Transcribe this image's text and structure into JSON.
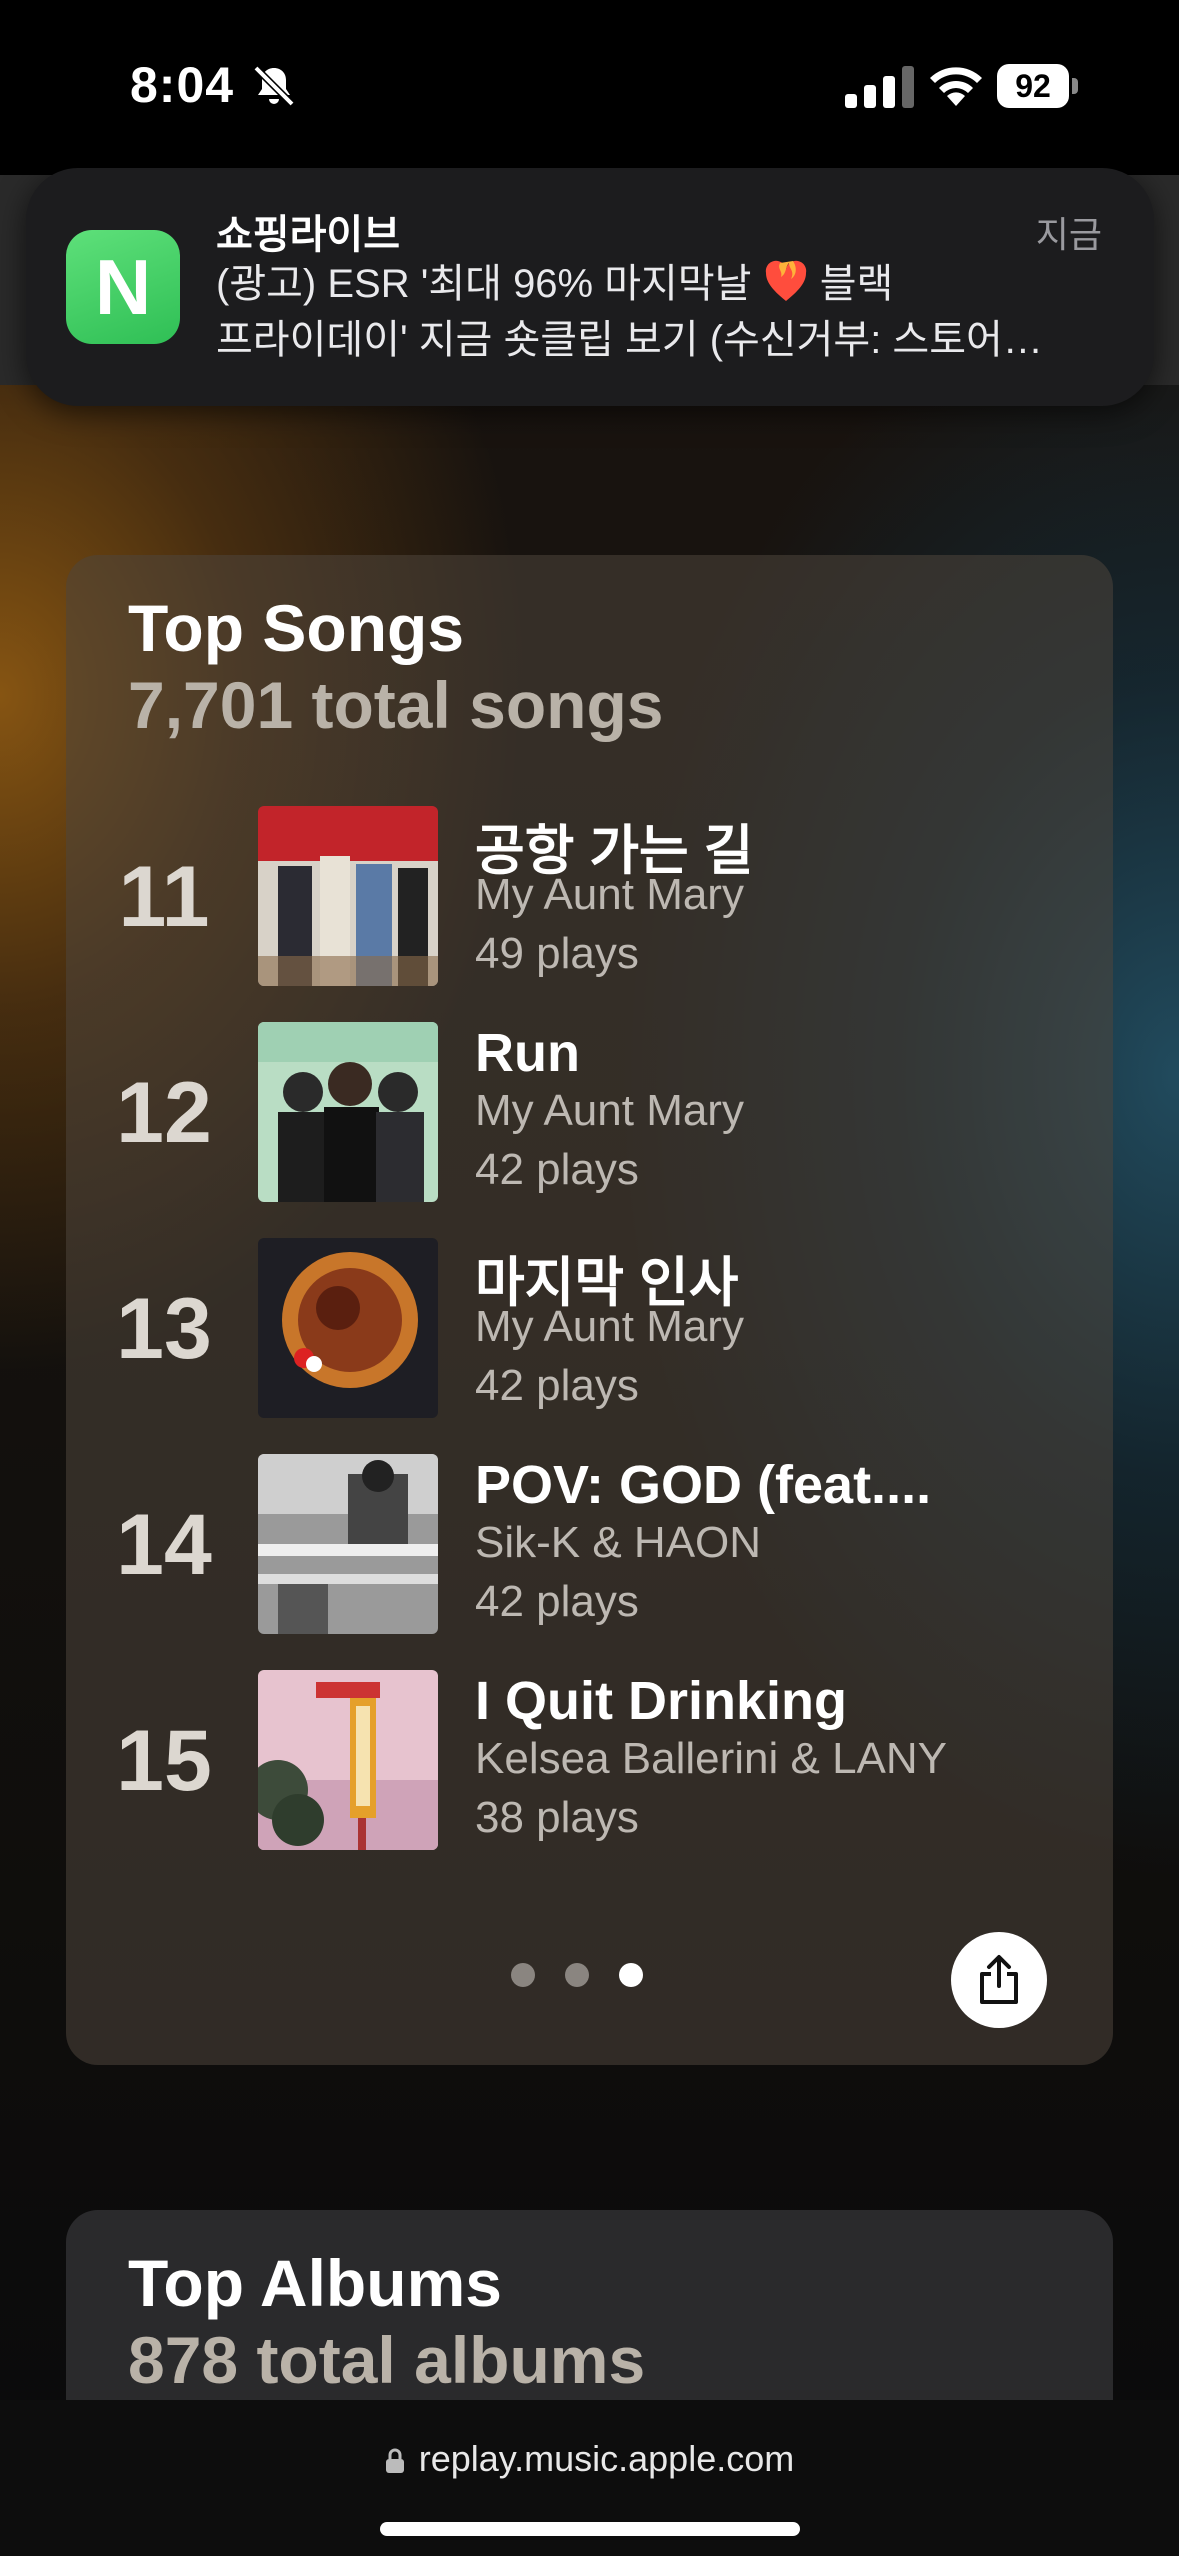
{
  "status_bar": {
    "time": "8:04",
    "battery": "92"
  },
  "notification": {
    "app_icon_letter": "N",
    "app_name": "쇼핑라이브",
    "time": "지금",
    "line1_a": "(광고) ESR '최대 96% 마지막날",
    "line1_b": "블랙",
    "line2": "프라이데이' 지금 숏클립 보기 (수신거부: 스토어…"
  },
  "top_songs": {
    "title": "Top Songs",
    "subtitle": "7,701 total songs",
    "songs": [
      {
        "rank": "11",
        "title": "공항 가는 길",
        "artist": "My Aunt Mary",
        "plays": "49 plays",
        "art_icon": "album-art-red-crowd"
      },
      {
        "rank": "12",
        "title": "Run",
        "artist": "My Aunt Mary",
        "plays": "42 plays",
        "art_icon": "album-art-right-now"
      },
      {
        "rank": "13",
        "title": "마지막 인사",
        "artist": "My Aunt Mary",
        "plays": "42 plays",
        "art_icon": "album-art-orange-sun"
      },
      {
        "rank": "14",
        "title": "POV: GOD (feat....",
        "artist": "Sik-K & HAON",
        "plays": "42 plays",
        "art_icon": "album-art-bw-photo"
      },
      {
        "rank": "15",
        "title": "I Quit Drinking",
        "artist": "Kelsea Ballerini & LANY",
        "plays": "38 plays",
        "art_icon": "album-art-liquor-sign"
      }
    ],
    "page_count": 3,
    "active_page": 3
  },
  "top_albums": {
    "title": "Top Albums",
    "subtitle": "878 total albums"
  },
  "browser": {
    "url": "replay.music.apple.com"
  }
}
